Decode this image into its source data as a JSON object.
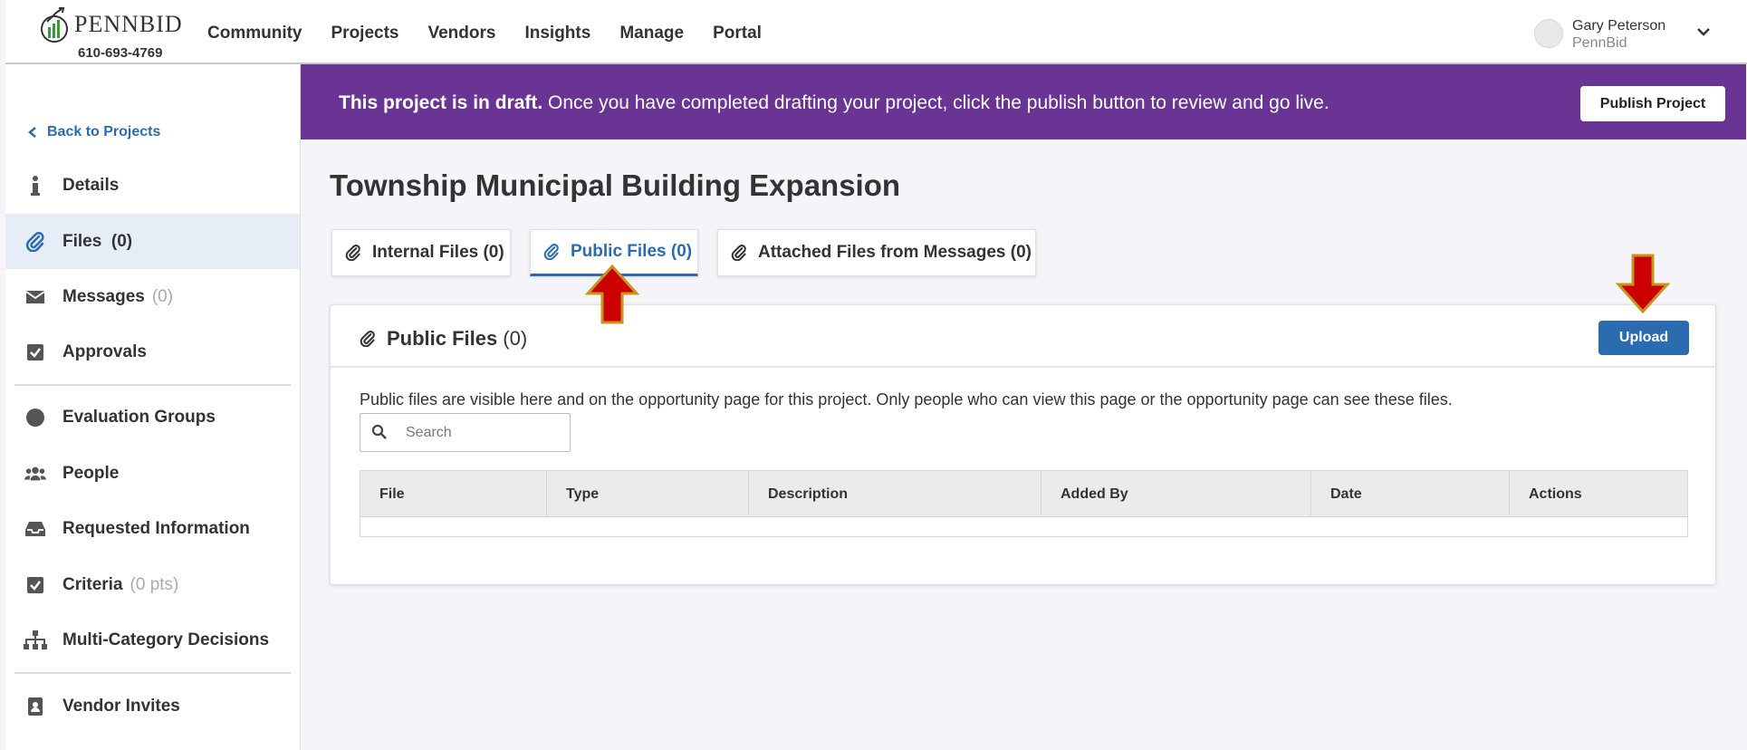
{
  "app": {
    "brand_name": "PENNBID",
    "brand_phone": "610-693-4769"
  },
  "nav": {
    "links": [
      "Community",
      "Projects",
      "Vendors",
      "Insights",
      "Manage",
      "Portal"
    ]
  },
  "user": {
    "name": "Gary Peterson",
    "org": "PennBid"
  },
  "sidebar": {
    "back_label": "Back to Projects",
    "items": [
      {
        "label": "Details",
        "count": "",
        "icon": "info-icon"
      },
      {
        "label": "Files",
        "count": "(0)",
        "icon": "paperclip-icon"
      },
      {
        "label": "Messages",
        "count": "(0)",
        "icon": "envelope-icon"
      },
      {
        "label": "Approvals",
        "count": "",
        "icon": "checkbox-icon"
      },
      {
        "label": "Evaluation Groups",
        "count": "",
        "icon": "circle-icon"
      },
      {
        "label": "People",
        "count": "",
        "icon": "users-icon"
      },
      {
        "label": "Requested Information",
        "count": "",
        "icon": "inbox-icon"
      },
      {
        "label": "Criteria",
        "count": "(0 pts)",
        "icon": "checkbox-icon"
      },
      {
        "label": "Multi-Category Decisions",
        "count": "",
        "icon": "sitemap-icon"
      },
      {
        "label": "Vendor Invites",
        "count": "",
        "icon": "address-book-icon"
      }
    ]
  },
  "banner": {
    "bold_text": "This project is in draft.",
    "text": " Once you have completed drafting your project, click the publish button to review and go live.",
    "publish_label": "Publish Project"
  },
  "main": {
    "title": "Township Municipal Building Expansion",
    "tabs": [
      {
        "label": "Internal Files (0)"
      },
      {
        "label": "Public Files (0)"
      },
      {
        "label": "Attached Files from Messages (0)"
      }
    ],
    "card": {
      "title": "Public Files",
      "count": "(0)",
      "upload_label": "Upload",
      "description": "Public files are visible here and on the opportunity page for this project. Only people who can view this page or the opportunity page can see these files.",
      "search_placeholder": "Search",
      "columns": [
        "File",
        "Type",
        "Description",
        "Added By",
        "Date",
        "Actions"
      ]
    }
  },
  "colors": {
    "banner": "#6a3494",
    "accent": "#2b6cb0",
    "arrow": "#cc0000"
  }
}
